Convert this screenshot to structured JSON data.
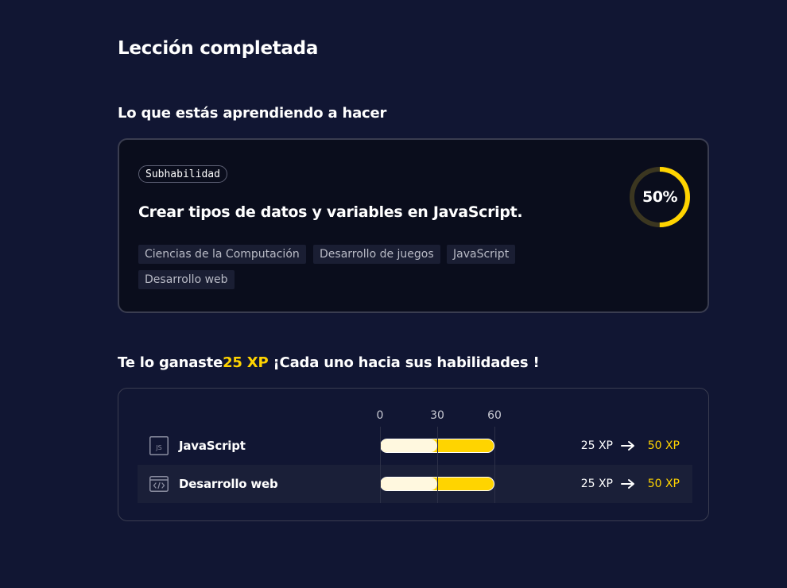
{
  "page": {
    "title": "Lección completada"
  },
  "learning": {
    "section_title": "Lo que estás aprendiendo a hacer",
    "badge": "Subhabilidad",
    "skill": "Crear tipos de datos y variables en JavaScript.",
    "tags": [
      "Ciencias de la Computación",
      "Desarrollo de juegos",
      "JavaScript",
      "Desarrollo web"
    ],
    "progress_label": "50%",
    "progress_value": 0.5,
    "colors": {
      "progress": "#ffd400",
      "track": "#3b3620"
    }
  },
  "xp": {
    "title_prefix": "Te lo ganaste",
    "title_amount": "25 XP",
    "title_suffix": " ¡Cada uno hacia sus habilidades !",
    "scale": [
      "0",
      "30",
      "60"
    ],
    "scale_max": 60,
    "rows": [
      {
        "name": "JavaScript",
        "icon": "js-file-icon",
        "from_xp": 25,
        "to_xp": 50,
        "from_label": "25 XP",
        "to_label": "50 XP"
      },
      {
        "name": "Desarrollo web",
        "icon": "code-window-icon",
        "from_xp": 25,
        "to_xp": 50,
        "from_label": "25 XP",
        "to_label": "50 XP"
      }
    ],
    "colors": {
      "accent": "#ffd400",
      "previous": "#fff8df"
    }
  }
}
